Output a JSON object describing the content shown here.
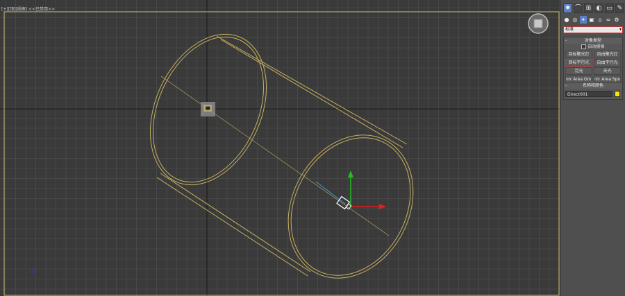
{
  "viewport": {
    "label": "[+][顶][线框] <<已禁用>>",
    "background": "#3a3a3a",
    "grid_color": "#4c4c4c",
    "axis_color": "#1e1e1e",
    "border_color": "#cfc070",
    "object_color": "#d8c070",
    "gizmo_x_color": "#e02020",
    "gizmo_y_color": "#20c020"
  },
  "command_panel": {
    "tabs": [
      {
        "icon": "sun-create-icon",
        "glyph": "✹"
      },
      {
        "icon": "modify-icon",
        "glyph": "⌒"
      },
      {
        "icon": "hierarchy-icon",
        "glyph": "⊞"
      },
      {
        "icon": "motion-icon",
        "glyph": "◐"
      },
      {
        "icon": "display-icon",
        "glyph": "▭"
      },
      {
        "icon": "utilities-icon",
        "glyph": "✎"
      }
    ],
    "subtabs": [
      {
        "icon": "geometry-icon",
        "glyph": "●"
      },
      {
        "icon": "shapes-icon",
        "glyph": "◎"
      },
      {
        "icon": "lights-icon",
        "glyph": "✦"
      },
      {
        "icon": "cameras-icon",
        "glyph": "▣"
      },
      {
        "icon": "helpers-icon",
        "glyph": "⌂"
      },
      {
        "icon": "spacewarps-icon",
        "glyph": "≈"
      },
      {
        "icon": "systems-icon",
        "glyph": "⚙"
      }
    ],
    "category_dropdown": {
      "value": "标准"
    },
    "object_type": {
      "title": "对象类型",
      "autogrid_label": "自动栅格",
      "buttons": [
        "目标聚光灯",
        "自由聚光灯",
        "目标平行光",
        "自由平行光",
        "泛光",
        "天光",
        "mr Area Omni",
        "mr Area Spot"
      ],
      "selected_button": "目标平行光"
    },
    "name_and_color": {
      "title": "名称和颜色",
      "name_value": "Direct001",
      "color": "#ffe600"
    }
  }
}
